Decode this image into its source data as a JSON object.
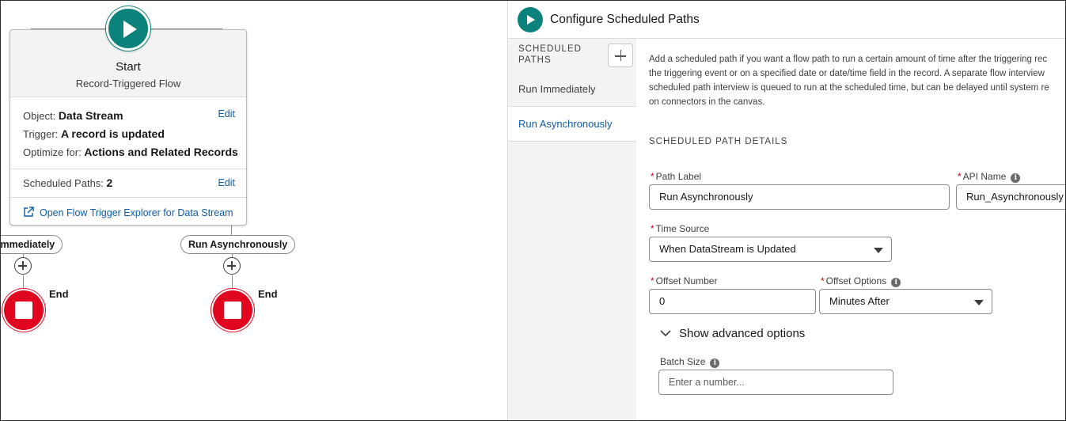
{
  "canvas": {
    "start_node": {
      "title": "Start",
      "subtitle": "Record-Triggered Flow",
      "object_label": "Object:",
      "object_value": "Data Stream",
      "trigger_label": "Trigger:",
      "trigger_value": "A record is updated",
      "optimize_label": "Optimize for:",
      "optimize_value": "Actions and Related Records",
      "edit_label": "Edit",
      "scheduled_paths_label": "Scheduled Paths:",
      "scheduled_paths_value": "2",
      "explorer_link": "Open Flow Trigger Explorer for Data Stream"
    },
    "paths": [
      {
        "label": "Run Immediately",
        "visible_label": "Immediately",
        "end_label": "End"
      },
      {
        "label": "Run Asynchronously",
        "visible_label": "Run Asynchronously",
        "end_label": "End"
      }
    ]
  },
  "panel": {
    "title": "Configure Scheduled Paths",
    "nav": {
      "header": "Scheduled Paths",
      "items": [
        "Run Immediately",
        "Run Asynchronously"
      ],
      "active_index": 1
    },
    "description_lines": [
      "Add a scheduled path if you want a flow path to run a certain amount of time after the triggering rec",
      "the triggering event or on a specified date or date/time field in the record. A separate flow interview",
      "scheduled path interview is queued to run at the scheduled time, but can be delayed until system re",
      "on connectors in the canvas."
    ],
    "section_title": "Scheduled Path Details",
    "required_marker": "*",
    "fields": {
      "path_label": {
        "label": "Path Label",
        "value": "Run Asynchronously"
      },
      "api_name": {
        "label": "API Name",
        "value": "Run_Asynchronously"
      },
      "time_source": {
        "label": "Time Source",
        "value": "When DataStream is Updated"
      },
      "offset_number": {
        "label": "Offset Number",
        "value": "0"
      },
      "offset_options": {
        "label": "Offset Options",
        "value": "Minutes After"
      },
      "batch_size": {
        "label": "Batch Size",
        "placeholder": "Enter a number..."
      }
    },
    "advanced_toggle": "Show advanced options"
  },
  "colors": {
    "start_teal": "#0b827c",
    "end_red": "#e1061f",
    "link_blue": "#0b5cab",
    "required_red": "#ba0517"
  },
  "icons": [
    "play-icon",
    "add-icon",
    "stop-icon",
    "external-link-icon",
    "info-icon",
    "chevron-down-icon",
    "dropdown-arrow-icon"
  ]
}
